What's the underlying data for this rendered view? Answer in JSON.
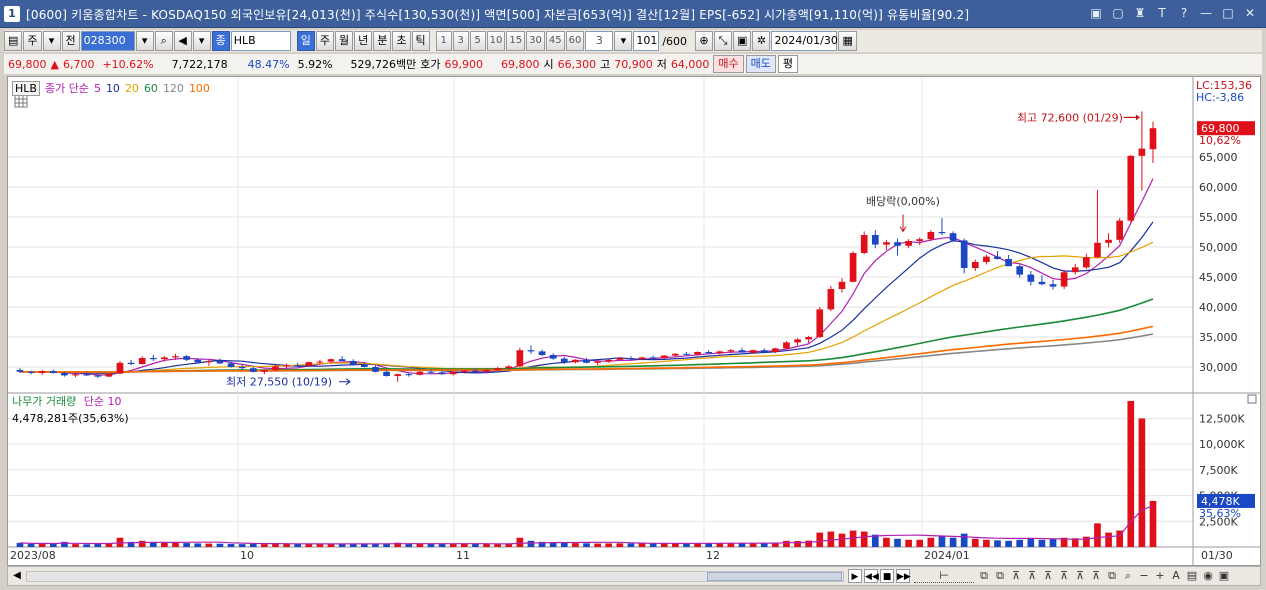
{
  "window": {
    "number": "1",
    "title": "[0600] 키움종합차트 - KOSDAQ150 외국인보유[24,013(천)] 주식수[130,530(천)] 액면[500] 자본금[653(억)] 결산[12월] EPS[-652] 시가총액[91,110(억)] 유통비율[90.2]",
    "icons": [
      "▣",
      "▢",
      "♜",
      "T",
      "?",
      "—",
      "□",
      "✕"
    ]
  },
  "toolbar": {
    "period_unit": "주",
    "prev_label": "전",
    "code": "028300",
    "item_type": "종",
    "item_name": "HLB",
    "period_buttons": [
      "일",
      "주",
      "월",
      "년",
      "분",
      "초",
      "틱"
    ],
    "active_period": "일",
    "numbers": [
      "1",
      "3",
      "5",
      "10",
      "15",
      "30",
      "45",
      "60"
    ],
    "num_dropdown": "3",
    "bar_count": "101",
    "bar_total": "/600",
    "date": "2024/01/30"
  },
  "pricebar": {
    "price": "69,800",
    "change_arrow": "▲",
    "change": "6,700",
    "change_pct": "+10.62%",
    "volume": "7,722,178",
    "ratio1": "48.47%",
    "ratio2": "5.92%",
    "amount": "529,726백만",
    "bid_label": "호가",
    "bid1": "69,900",
    "bid2": "69,800",
    "open_label": "시",
    "open": "66,300",
    "high_label": "고",
    "high": "70,900",
    "low_label": "저",
    "low": "64,000",
    "buy": "매수",
    "sell": "매도",
    "eval": "평"
  },
  "legend": {
    "tag": "HLB",
    "ma_label": "종가 단순",
    "ma_periods": [
      "5",
      "10",
      "20",
      "60",
      "120",
      "100"
    ],
    "ma_colors": [
      "#b020b0",
      "#1a2fa0",
      "#e8a000",
      "#1a8a3a",
      "#888888",
      "#ff6a00"
    ],
    "vol_label": "나무가 거래량",
    "vol_ma": "단순 10",
    "vol_value": "4,478,281주(35,63%)"
  },
  "annotations": {
    "high_text": "최고 72,600 (01/29)",
    "low_text": "최저 27,550 (10/19)",
    "dividend_text": "배당락(0,00%)"
  },
  "right_axis": {
    "lc": "LC:153,36",
    "hc": "HC:-3,86",
    "price_tag": "69,800",
    "pct_tag": "10,62%",
    "vol_tag": "4,478K",
    "vol_pct_tag": "35,63%"
  },
  "chart_data": {
    "type": "candlestick",
    "price_ticks": [
      "65,000",
      "60,000",
      "55,000",
      "50,000",
      "45,000",
      "40,000",
      "35,000",
      "30,000"
    ],
    "price_tick_values": [
      65000,
      60000,
      55000,
      50000,
      45000,
      40000,
      35000,
      30000
    ],
    "volume_ticks": [
      "12,500K",
      "10,000K",
      "7,500K",
      "5,000K",
      "2,500K"
    ],
    "volume_tick_values": [
      12500,
      10000,
      7500,
      5000,
      2500
    ],
    "x_labels": [
      "2023/08",
      "10",
      "11",
      "12",
      "2024/01",
      "01/30"
    ],
    "ylim": [
      26000,
      76000
    ],
    "vol_ylim": [
      0,
      14000
    ],
    "candles": [
      [
        29500,
        29800,
        29000,
        29200,
        400
      ],
      [
        29200,
        29400,
        28800,
        29000,
        300
      ],
      [
        29000,
        29500,
        28700,
        29300,
        350
      ],
      [
        29300,
        29600,
        28900,
        29000,
        320
      ],
      [
        29000,
        29200,
        28400,
        28600,
        500
      ],
      [
        28600,
        28900,
        28300,
        28800,
        280
      ],
      [
        28800,
        29100,
        28500,
        28600,
        260
      ],
      [
        28600,
        28800,
        28200,
        28400,
        300
      ],
      [
        28400,
        29000,
        28300,
        28900,
        350
      ],
      [
        28900,
        31000,
        28800,
        30700,
        900
      ],
      [
        30700,
        31200,
        30300,
        30500,
        500
      ],
      [
        30500,
        31800,
        30400,
        31500,
        600
      ],
      [
        31500,
        32000,
        31000,
        31300,
        450
      ],
      [
        31300,
        31800,
        30900,
        31600,
        420
      ],
      [
        31600,
        32200,
        31200,
        31800,
        400
      ],
      [
        31800,
        32000,
        31000,
        31200,
        380
      ],
      [
        31200,
        31500,
        30600,
        30800,
        350
      ],
      [
        30800,
        31200,
        30200,
        31000,
        330
      ],
      [
        31000,
        31400,
        30500,
        30600,
        320
      ],
      [
        30600,
        30900,
        29900,
        30000,
        300
      ],
      [
        30000,
        30400,
        29600,
        29800,
        280
      ],
      [
        29800,
        30100,
        29100,
        29200,
        300
      ],
      [
        29200,
        29600,
        28800,
        29500,
        270
      ],
      [
        29500,
        30300,
        29300,
        30100,
        330
      ],
      [
        30100,
        30600,
        29800,
        30300,
        320
      ],
      [
        30300,
        30700,
        30000,
        30200,
        300
      ],
      [
        30200,
        30900,
        30000,
        30800,
        320
      ],
      [
        30800,
        31200,
        30500,
        30900,
        300
      ],
      [
        30900,
        31400,
        30600,
        31300,
        320
      ],
      [
        31300,
        31800,
        31000,
        31000,
        310
      ],
      [
        31000,
        31300,
        30300,
        30400,
        300
      ],
      [
        30400,
        30800,
        29900,
        30000,
        290
      ],
      [
        30000,
        30300,
        29100,
        29200,
        310
      ],
      [
        29200,
        29400,
        28400,
        28500,
        350
      ],
      [
        28500,
        28900,
        27550,
        28800,
        420
      ],
      [
        28800,
        29000,
        28400,
        28700,
        300
      ],
      [
        28700,
        29400,
        28600,
        29200,
        310
      ],
      [
        29200,
        29600,
        28900,
        29100,
        300
      ],
      [
        29100,
        29400,
        28700,
        28800,
        290
      ],
      [
        28800,
        29300,
        28600,
        29200,
        300
      ],
      [
        29200,
        29500,
        28900,
        29400,
        300
      ],
      [
        29400,
        29700,
        29100,
        29300,
        290
      ],
      [
        29300,
        29600,
        29000,
        29500,
        300
      ],
      [
        29500,
        30000,
        29300,
        29800,
        310
      ],
      [
        29800,
        30300,
        29500,
        30100,
        320
      ],
      [
        30100,
        33200,
        30000,
        32800,
        900
      ],
      [
        32800,
        33600,
        32200,
        32600,
        600
      ],
      [
        32600,
        32900,
        31800,
        32000,
        500
      ],
      [
        32000,
        32300,
        31200,
        31400,
        420
      ],
      [
        31400,
        31700,
        30500,
        30800,
        400
      ],
      [
        30800,
        31300,
        30600,
        31200,
        380
      ],
      [
        31200,
        31500,
        30600,
        30700,
        360
      ],
      [
        30700,
        31000,
        30300,
        30900,
        340
      ],
      [
        30900,
        31300,
        30700,
        31200,
        350
      ],
      [
        31200,
        31600,
        31000,
        31500,
        360
      ],
      [
        31500,
        31800,
        31100,
        31300,
        340
      ],
      [
        31300,
        31700,
        31100,
        31600,
        350
      ],
      [
        31600,
        31900,
        31300,
        31500,
        340
      ],
      [
        31500,
        32000,
        31300,
        31900,
        360
      ],
      [
        31900,
        32300,
        31600,
        32200,
        380
      ],
      [
        32200,
        32500,
        31900,
        32100,
        360
      ],
      [
        32100,
        32600,
        31900,
        32500,
        380
      ],
      [
        32500,
        32800,
        32100,
        32300,
        370
      ],
      [
        32300,
        32700,
        32100,
        32600,
        380
      ],
      [
        32600,
        33000,
        32300,
        32800,
        390
      ],
      [
        32800,
        33200,
        32500,
        32400,
        380
      ],
      [
        32400,
        32900,
        32200,
        32800,
        390
      ],
      [
        32800,
        33100,
        32400,
        32500,
        380
      ],
      [
        32500,
        33200,
        32300,
        33100,
        420
      ],
      [
        33100,
        34300,
        33000,
        34100,
        600
      ],
      [
        34100,
        34800,
        33600,
        34600,
        580
      ],
      [
        34600,
        35200,
        34000,
        35000,
        620
      ],
      [
        35000,
        40000,
        34800,
        39600,
        1400
      ],
      [
        39600,
        43500,
        39300,
        43000,
        1500
      ],
      [
        43000,
        44800,
        42400,
        44200,
        1300
      ],
      [
        44200,
        49300,
        44100,
        49000,
        1600
      ],
      [
        49000,
        52600,
        48800,
        52000,
        1500
      ],
      [
        52000,
        52800,
        49800,
        50400,
        1200
      ],
      [
        50400,
        51200,
        49500,
        50800,
        900
      ],
      [
        50800,
        51400,
        48600,
        50200,
        800
      ],
      [
        50200,
        51300,
        49800,
        51000,
        700
      ],
      [
        51000,
        51600,
        50300,
        51300,
        700
      ],
      [
        51300,
        52800,
        51000,
        52500,
        900
      ],
      [
        52500,
        54800,
        52000,
        52300,
        1100
      ],
      [
        52300,
        52600,
        50800,
        51100,
        900
      ],
      [
        51100,
        51400,
        45600,
        46500,
        1300
      ],
      [
        46500,
        47900,
        46000,
        47500,
        800
      ],
      [
        47500,
        48700,
        47100,
        48400,
        700
      ],
      [
        48400,
        49300,
        47900,
        48000,
        650
      ],
      [
        48000,
        48700,
        47400,
        46800,
        600
      ],
      [
        46800,
        47100,
        44900,
        45400,
        700
      ],
      [
        45400,
        46000,
        43600,
        44200,
        800
      ],
      [
        44200,
        45300,
        43600,
        43800,
        700
      ],
      [
        43800,
        44500,
        42900,
        43400,
        750
      ],
      [
        43400,
        46200,
        43000,
        45800,
        900
      ],
      [
        45800,
        47200,
        45400,
        46600,
        850
      ],
      [
        46600,
        48900,
        46300,
        48300,
        1000
      ],
      [
        48300,
        59500,
        48100,
        50700,
        2300
      ],
      [
        50700,
        52300,
        49900,
        51200,
        1400
      ],
      [
        51200,
        54800,
        50700,
        54400,
        1600
      ],
      [
        54400,
        65300,
        54100,
        65200,
        14200
      ],
      [
        65200,
        72600,
        59400,
        66400,
        12500
      ],
      [
        66300,
        70900,
        64000,
        69800,
        4478
      ]
    ]
  }
}
